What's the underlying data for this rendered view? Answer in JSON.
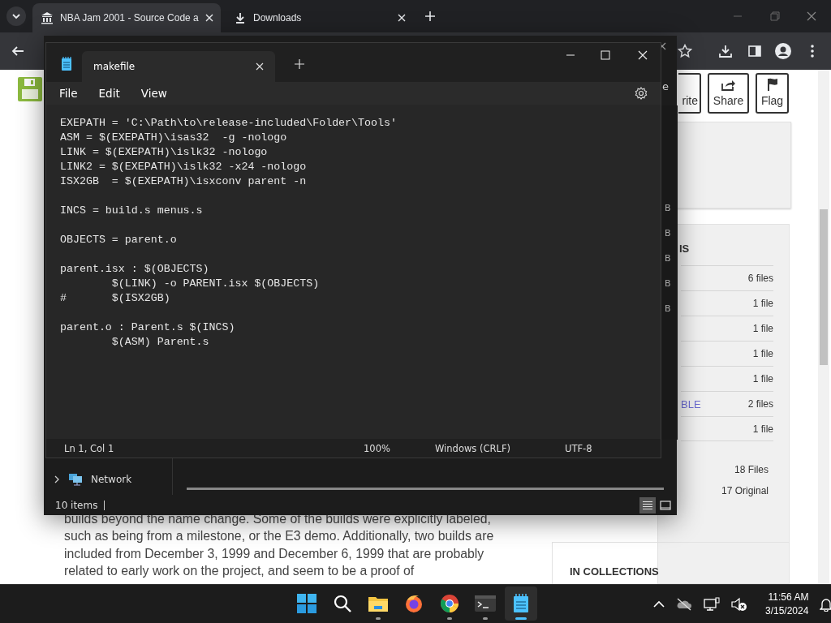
{
  "browser": {
    "tabs": [
      {
        "title": "NBA Jam 2001 - Source Code a",
        "selected": true
      },
      {
        "title": "Downloads",
        "selected": false
      }
    ],
    "page": {
      "actions": [
        {
          "label": "rite",
          "kind": "favorite"
        },
        {
          "label": "Share",
          "kind": "share"
        },
        {
          "label": "Flag",
          "kind": "flag"
        }
      ],
      "files_panel": {
        "heading": "IS",
        "rows": [
          {
            "count": "6 files"
          },
          {
            "count": "1 file"
          },
          {
            "count": "1 file"
          },
          {
            "count": "1 file"
          },
          {
            "count": "1 file"
          },
          {
            "label": "BLE",
            "count": "2 files"
          },
          {
            "count": "1 file"
          }
        ],
        "totals": [
          "18 Files",
          "17 Original"
        ]
      },
      "collections_heading": "IN COLLECTIONS",
      "paragraph": "builds beyond the name change. Some of the builds were explicitly labeled, such as being from a milestone, or the E3 demo. Additionally, two builds are included from December 3, 1999 and December 6, 1999 that are probably related to early work on the project, and seem to be a proof of"
    }
  },
  "explorer": {
    "fragment": "e",
    "size_column": [
      "B",
      "B",
      "B",
      "B",
      "B"
    ],
    "nav": [
      {
        "label": "Network",
        "expanded": false
      }
    ],
    "status": "10 items",
    "view_buttons": [
      {
        "kind": "details",
        "selected": true
      },
      {
        "kind": "tiles",
        "selected": false
      }
    ]
  },
  "notepad": {
    "title": "makefile",
    "menu": [
      "File",
      "Edit",
      "View"
    ],
    "blocks": [
      [
        "EXEPATH = 'C:\\Path\\to\\release-included\\Folder\\Tools'",
        "ASM = $(EXEPATH)\\isas32  -g -nologo",
        "LINK = $(EXEPATH)\\islk32 -nologo",
        "LINK2 = $(EXEPATH)\\islk32 -x24 -nologo",
        "ISX2GB  = $(EXEPATH)\\isxconv parent -n"
      ],
      [
        "INCS = build.s menus.s"
      ],
      [
        "OBJECTS = parent.o"
      ],
      [
        "parent.isx : $(OBJECTS)",
        "        $(LINK) -o PARENT.isx $(OBJECTS)",
        "#       $(ISX2GB)"
      ],
      [
        "parent.o : Parent.s $(INCS)",
        "        $(ASM) Parent.s"
      ]
    ],
    "status": {
      "position": "Ln 1, Col 1",
      "zoom": "100%",
      "line_ending": "Windows (CRLF)",
      "encoding": "UTF-8"
    }
  },
  "taskbar": {
    "apps": [
      {
        "kind": "start",
        "running": false,
        "active": false
      },
      {
        "kind": "search",
        "running": false,
        "active": false
      },
      {
        "kind": "folder",
        "running": true,
        "active": false
      },
      {
        "kind": "firefox",
        "running": false,
        "active": false
      },
      {
        "kind": "chrome",
        "running": true,
        "active": false
      },
      {
        "kind": "terminal",
        "running": true,
        "active": false
      },
      {
        "kind": "notepad",
        "running": true,
        "active": true
      }
    ],
    "time": "11:56 AM",
    "date": "3/15/2024"
  }
}
